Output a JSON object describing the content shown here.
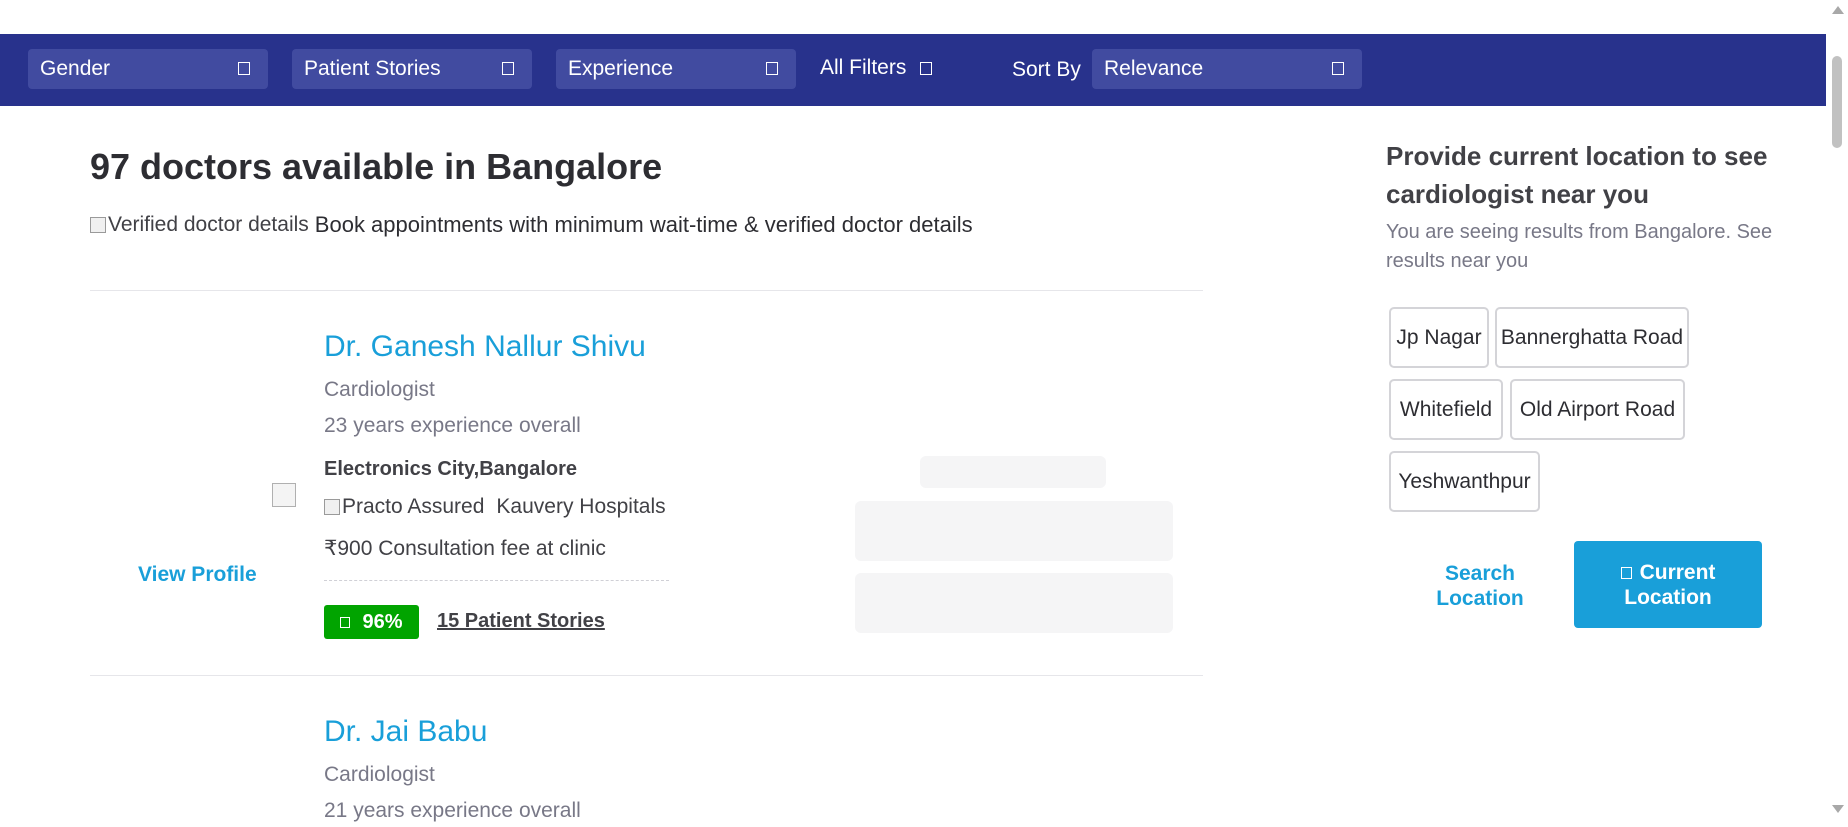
{
  "filters": {
    "gender": "Gender",
    "patient_stories": "Patient Stories",
    "experience": "Experience",
    "all_filters": "All Filters",
    "sort_by_label": "Sort By",
    "sort_by_value": "Relevance"
  },
  "results": {
    "heading": "97 doctors available in Bangalore",
    "verified_alt": "Verified doctor details",
    "verified_text": "Book appointments with minimum wait-time & verified doctor details"
  },
  "doctors": [
    {
      "name": "Dr. Ganesh Nallur Shivu",
      "specialty": "Cardiologist",
      "experience": "23 years experience overall",
      "location": "Electronics City,Bangalore",
      "assured_alt": "Practo Assured",
      "clinic": "Kauvery Hospitals",
      "fee": "₹900 Consultation fee at clinic",
      "rating": "96%",
      "stories": "15 Patient Stories",
      "view_profile": "View Profile"
    },
    {
      "name": "Dr. Jai Babu",
      "specialty": "Cardiologist",
      "experience": "21 years experience overall"
    }
  ],
  "sidebar": {
    "title": "Provide current location to see cardiologist near you",
    "subtitle": "You are seeing results from Bangalore. See results near you",
    "localities": [
      "Jp Nagar",
      "Bannerghatta Road",
      "Whitefield",
      "Old Airport Road",
      "Yeshwanthpur"
    ],
    "search_location": "Search Location",
    "current_location": "Current Location"
  },
  "colors": {
    "brand_navy": "#28328c",
    "accent_blue": "#199fd9",
    "rating_green": "#01a400"
  }
}
